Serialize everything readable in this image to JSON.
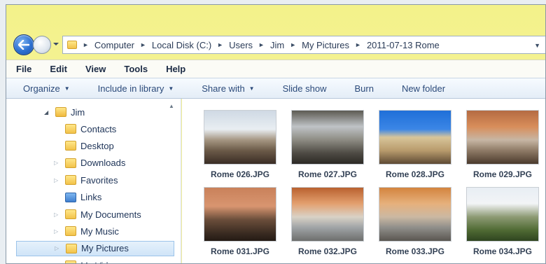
{
  "address": {
    "crumbs": [
      "Computer",
      "Local Disk (C:)",
      "Users",
      "Jim",
      "My Pictures",
      "2011-07-13 Rome"
    ]
  },
  "menu": [
    "File",
    "Edit",
    "View",
    "Tools",
    "Help"
  ],
  "commands": [
    {
      "label": "Organize",
      "dropdown": true
    },
    {
      "label": "Include in library",
      "dropdown": true
    },
    {
      "label": "Share with",
      "dropdown": true
    },
    {
      "label": "Slide show",
      "dropdown": false
    },
    {
      "label": "Burn",
      "dropdown": false
    },
    {
      "label": "New folder",
      "dropdown": false
    }
  ],
  "tree": {
    "root": "Jim",
    "items": [
      {
        "label": "Contacts",
        "icon": "contacts-folder-icon",
        "expandable": false
      },
      {
        "label": "Desktop",
        "icon": "desktop-folder-icon",
        "expandable": false
      },
      {
        "label": "Downloads",
        "icon": "downloads-folder-icon",
        "expandable": true
      },
      {
        "label": "Favorites",
        "icon": "favorites-folder-icon",
        "expandable": true
      },
      {
        "label": "Links",
        "icon": "links-folder-icon",
        "expandable": false
      },
      {
        "label": "My Documents",
        "icon": "documents-folder-icon",
        "expandable": true
      },
      {
        "label": "My Music",
        "icon": "music-folder-icon",
        "expandable": true
      },
      {
        "label": "My Pictures",
        "icon": "pictures-folder-icon",
        "expandable": true,
        "selected": true
      },
      {
        "label": "My Videos",
        "icon": "videos-folder-icon",
        "expandable": true
      }
    ]
  },
  "files": [
    {
      "name": "Rome 026.JPG"
    },
    {
      "name": "Rome 027.JPG"
    },
    {
      "name": "Rome 028.JPG"
    },
    {
      "name": "Rome 029.JPG"
    },
    {
      "name": "Rome 031.JPG"
    },
    {
      "name": "Rome 032.JPG"
    },
    {
      "name": "Rome 033.JPG"
    },
    {
      "name": "Rome 034.JPG"
    }
  ],
  "colors": {
    "title_bar": "#f4ee9f",
    "accent": "#2c6fd0",
    "selection": "#cfe4f8"
  }
}
